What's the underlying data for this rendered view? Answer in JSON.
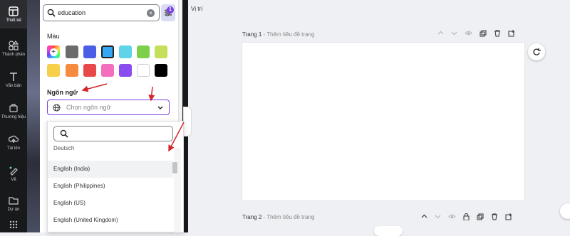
{
  "sidebar": {
    "items": [
      {
        "label": "Thiết kế",
        "icon": "layout-icon"
      },
      {
        "label": "Thành phần",
        "icon": "shapes-icon"
      },
      {
        "label": "Văn bản",
        "icon": "text-icon"
      },
      {
        "label": "Thương hiệu",
        "icon": "brand-icon"
      },
      {
        "label": "Tải lên",
        "icon": "upload-icon"
      },
      {
        "label": "Vẽ",
        "icon": "draw-icon"
      },
      {
        "label": "Dự án",
        "icon": "folder-icon"
      }
    ]
  },
  "search": {
    "value": "education",
    "filter_count": "1"
  },
  "filters": {
    "color_title": "Màu",
    "colors": [
      "#6b6b6b",
      "#4b5ee6",
      "#35a8f5",
      "#5fd3e8",
      "#7ed04a",
      "#c4e05a",
      "#f6d04a",
      "#f58b3f",
      "#e8484a",
      "#f36fbd",
      "#8b4cf0",
      "#ffffff",
      "#000000"
    ],
    "language_title": "Ngôn ngữ",
    "language_placeholder": "Chọn ngôn ngữ",
    "languages": [
      "Deutsch",
      "English (India)",
      "English (Philippines)",
      "English (US)",
      "English (United Kingdom)"
    ],
    "highlighted_language": "English (India)"
  },
  "editor": {
    "position_label": "Vị trí",
    "pages": [
      {
        "title": "Trang 1",
        "subtitle": "Thêm tiêu đề trang"
      },
      {
        "title": "Trang 2",
        "subtitle": "Thêm tiêu đề trang"
      }
    ]
  },
  "colors": {
    "accent": "#7b3fe4",
    "arrow": "#d2262b",
    "rail_bg": "#18191b"
  }
}
